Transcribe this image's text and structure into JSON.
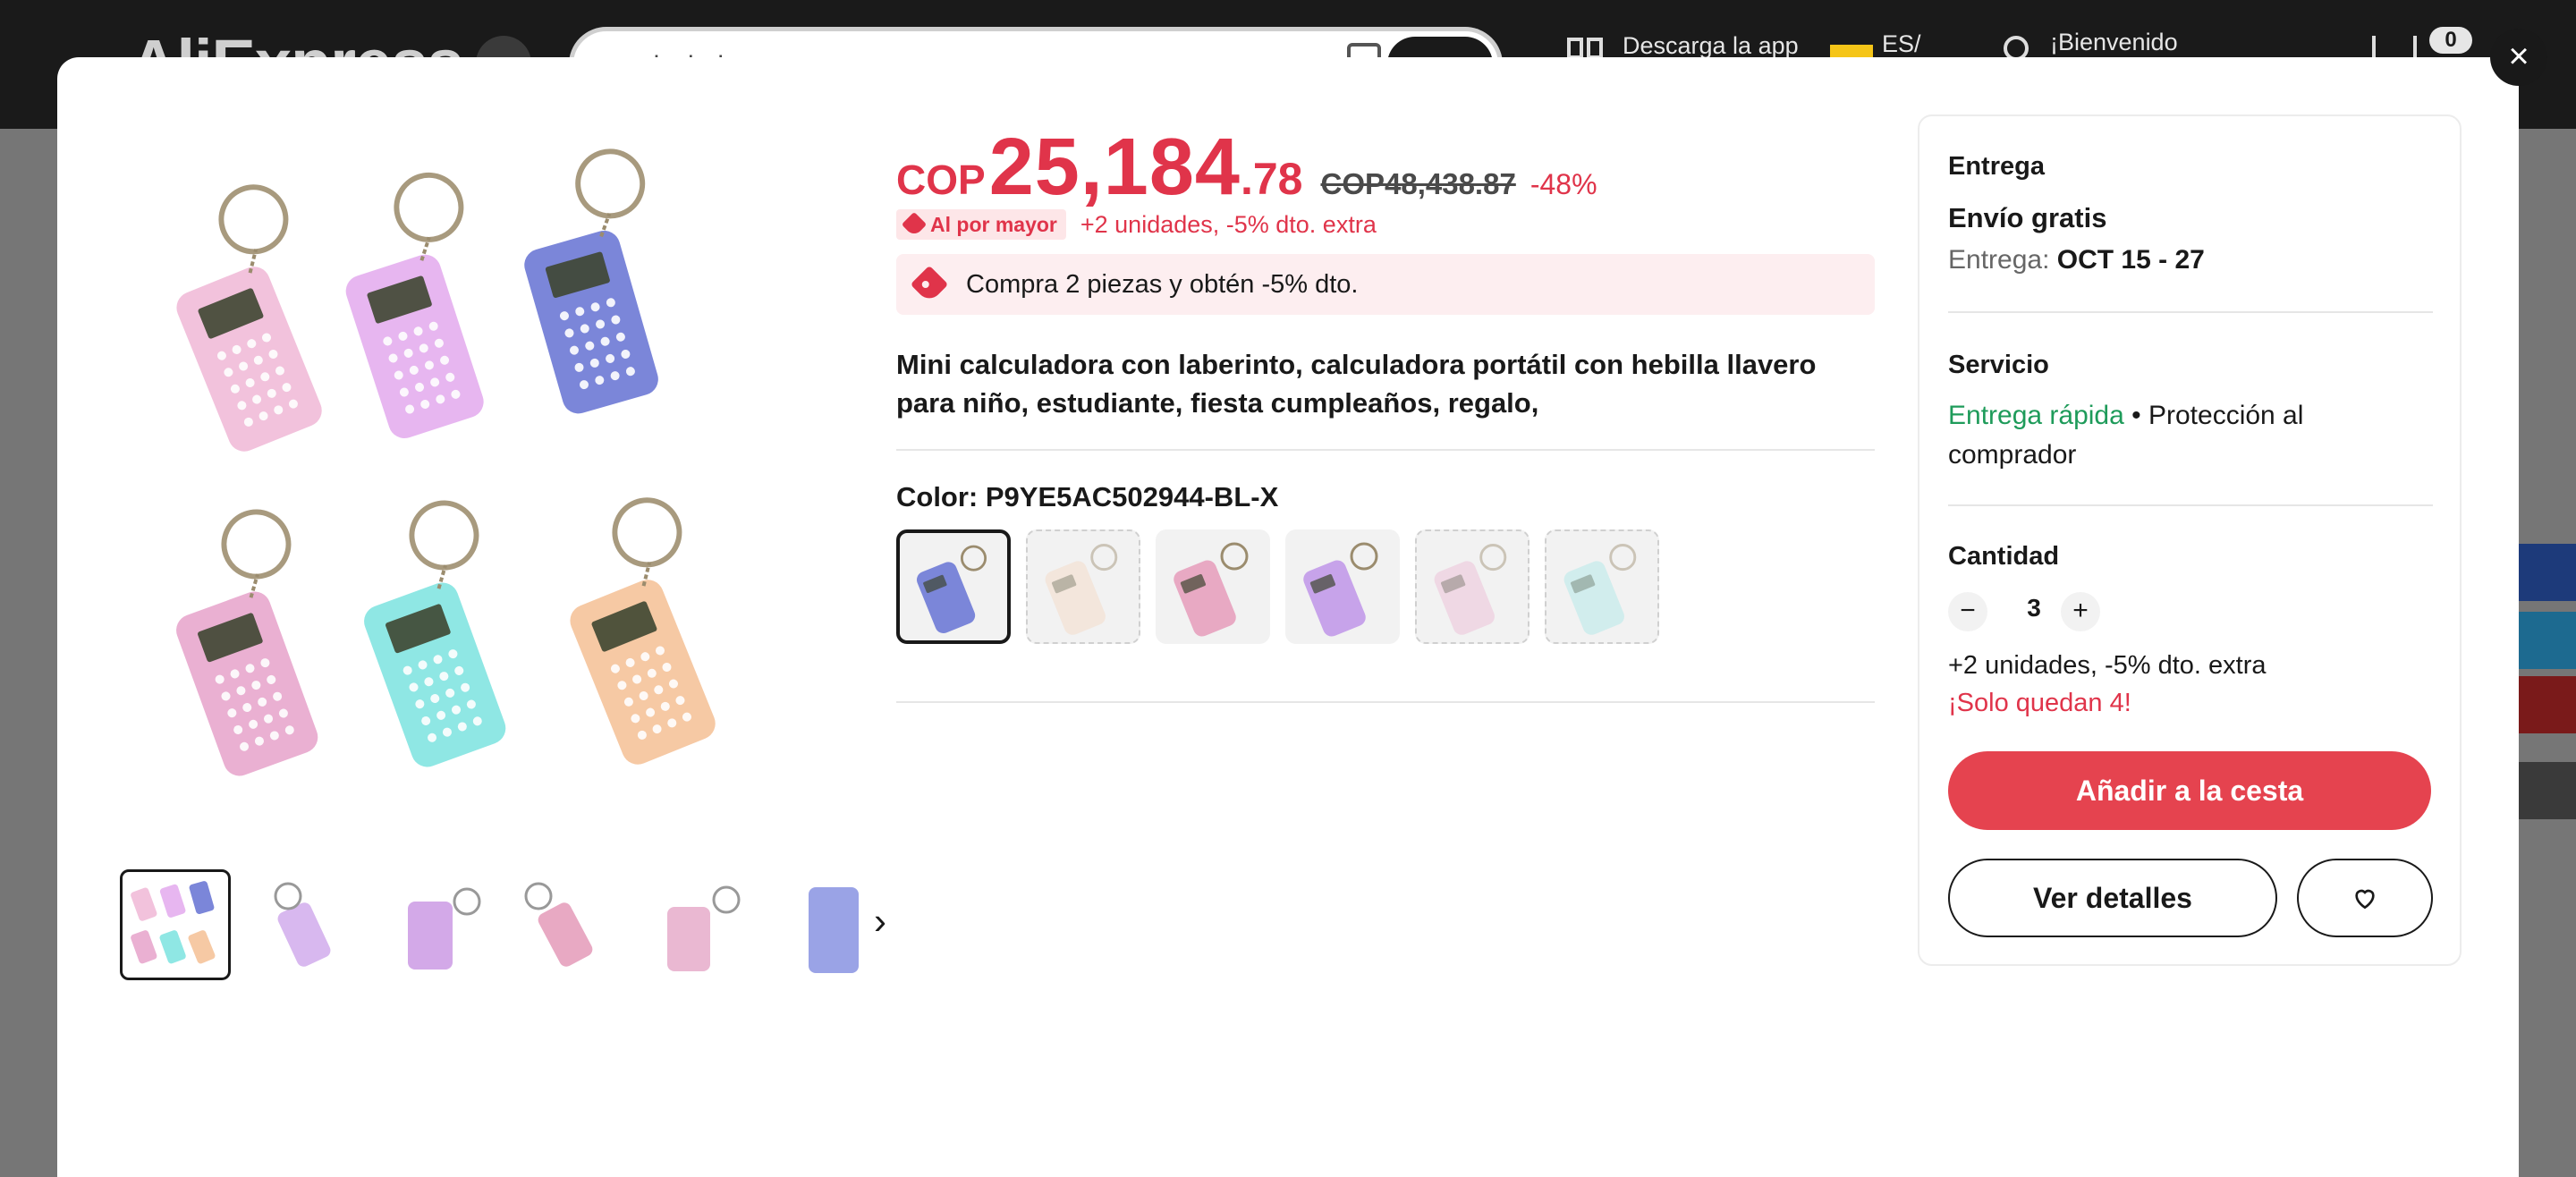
{
  "site": {
    "logo": "AliExpress",
    "search_text": "calculadora",
    "app_label": "Descarga la app",
    "lang_label": "ES/",
    "welcome": "¡Bienvenido",
    "cart_count": "0"
  },
  "modal": {
    "close_label": "×",
    "price": {
      "currency": "COP",
      "integer": "25,184",
      "decimal": ".78",
      "original": "COP48,438.87",
      "discount": "-48%"
    },
    "bulk": {
      "badge": "Al por mayor",
      "text": "+2 unidades, -5% dto. extra"
    },
    "promo": "Compra 2 piezas y obtén -5% dto.",
    "title": "Mini calculadora con laberinto, calculadora portátil con hebilla llavero para niño, estudiante, fiesta cumpleaños, regalo,",
    "color_label": "Color: P9YE5AC502944-BL-X",
    "swatches": [
      {
        "color": "#7b86d9",
        "state": "selected"
      },
      {
        "color": "#f3d8c2",
        "state": "out-of-stock"
      },
      {
        "color": "#e8a9c3",
        "state": "available"
      },
      {
        "color": "#c7a3ea",
        "state": "available"
      },
      {
        "color": "#eab8d2",
        "state": "out-of-stock"
      },
      {
        "color": "#a9e6e6",
        "state": "out-of-stock"
      }
    ],
    "thumb_colors": [
      "#d8b8ef",
      "#e8a9c3",
      "#d3a9e8",
      "#eab8d2",
      "#9aa3e6"
    ]
  },
  "panel": {
    "delivery_heading": "Entrega",
    "free_shipping": "Envío gratis",
    "delivery_label": "Entrega: ",
    "delivery_dates": "OCT 15 - 27",
    "service_heading": "Servicio",
    "fast_delivery": "Entrega rápida",
    "protection_1": " • Protección al",
    "protection_2": "comprador",
    "qty_heading": "Cantidad",
    "qty_minus": "−",
    "qty_value": "3",
    "qty_plus": "+",
    "bulk_note": "+2 unidades, -5% dto. extra",
    "stock_note": "¡Solo quedan 4!",
    "add_cart": "Añadir a la cesta",
    "details": "Ver detalles"
  },
  "icons": {
    "close": "close-icon",
    "tag": "price-tag-icon",
    "heart": "heart-icon",
    "chevron": "chevron-right-icon"
  },
  "colors": {
    "accent": "#e0344a",
    "cart_button": "#e5434f",
    "green": "#1e9b5a"
  }
}
